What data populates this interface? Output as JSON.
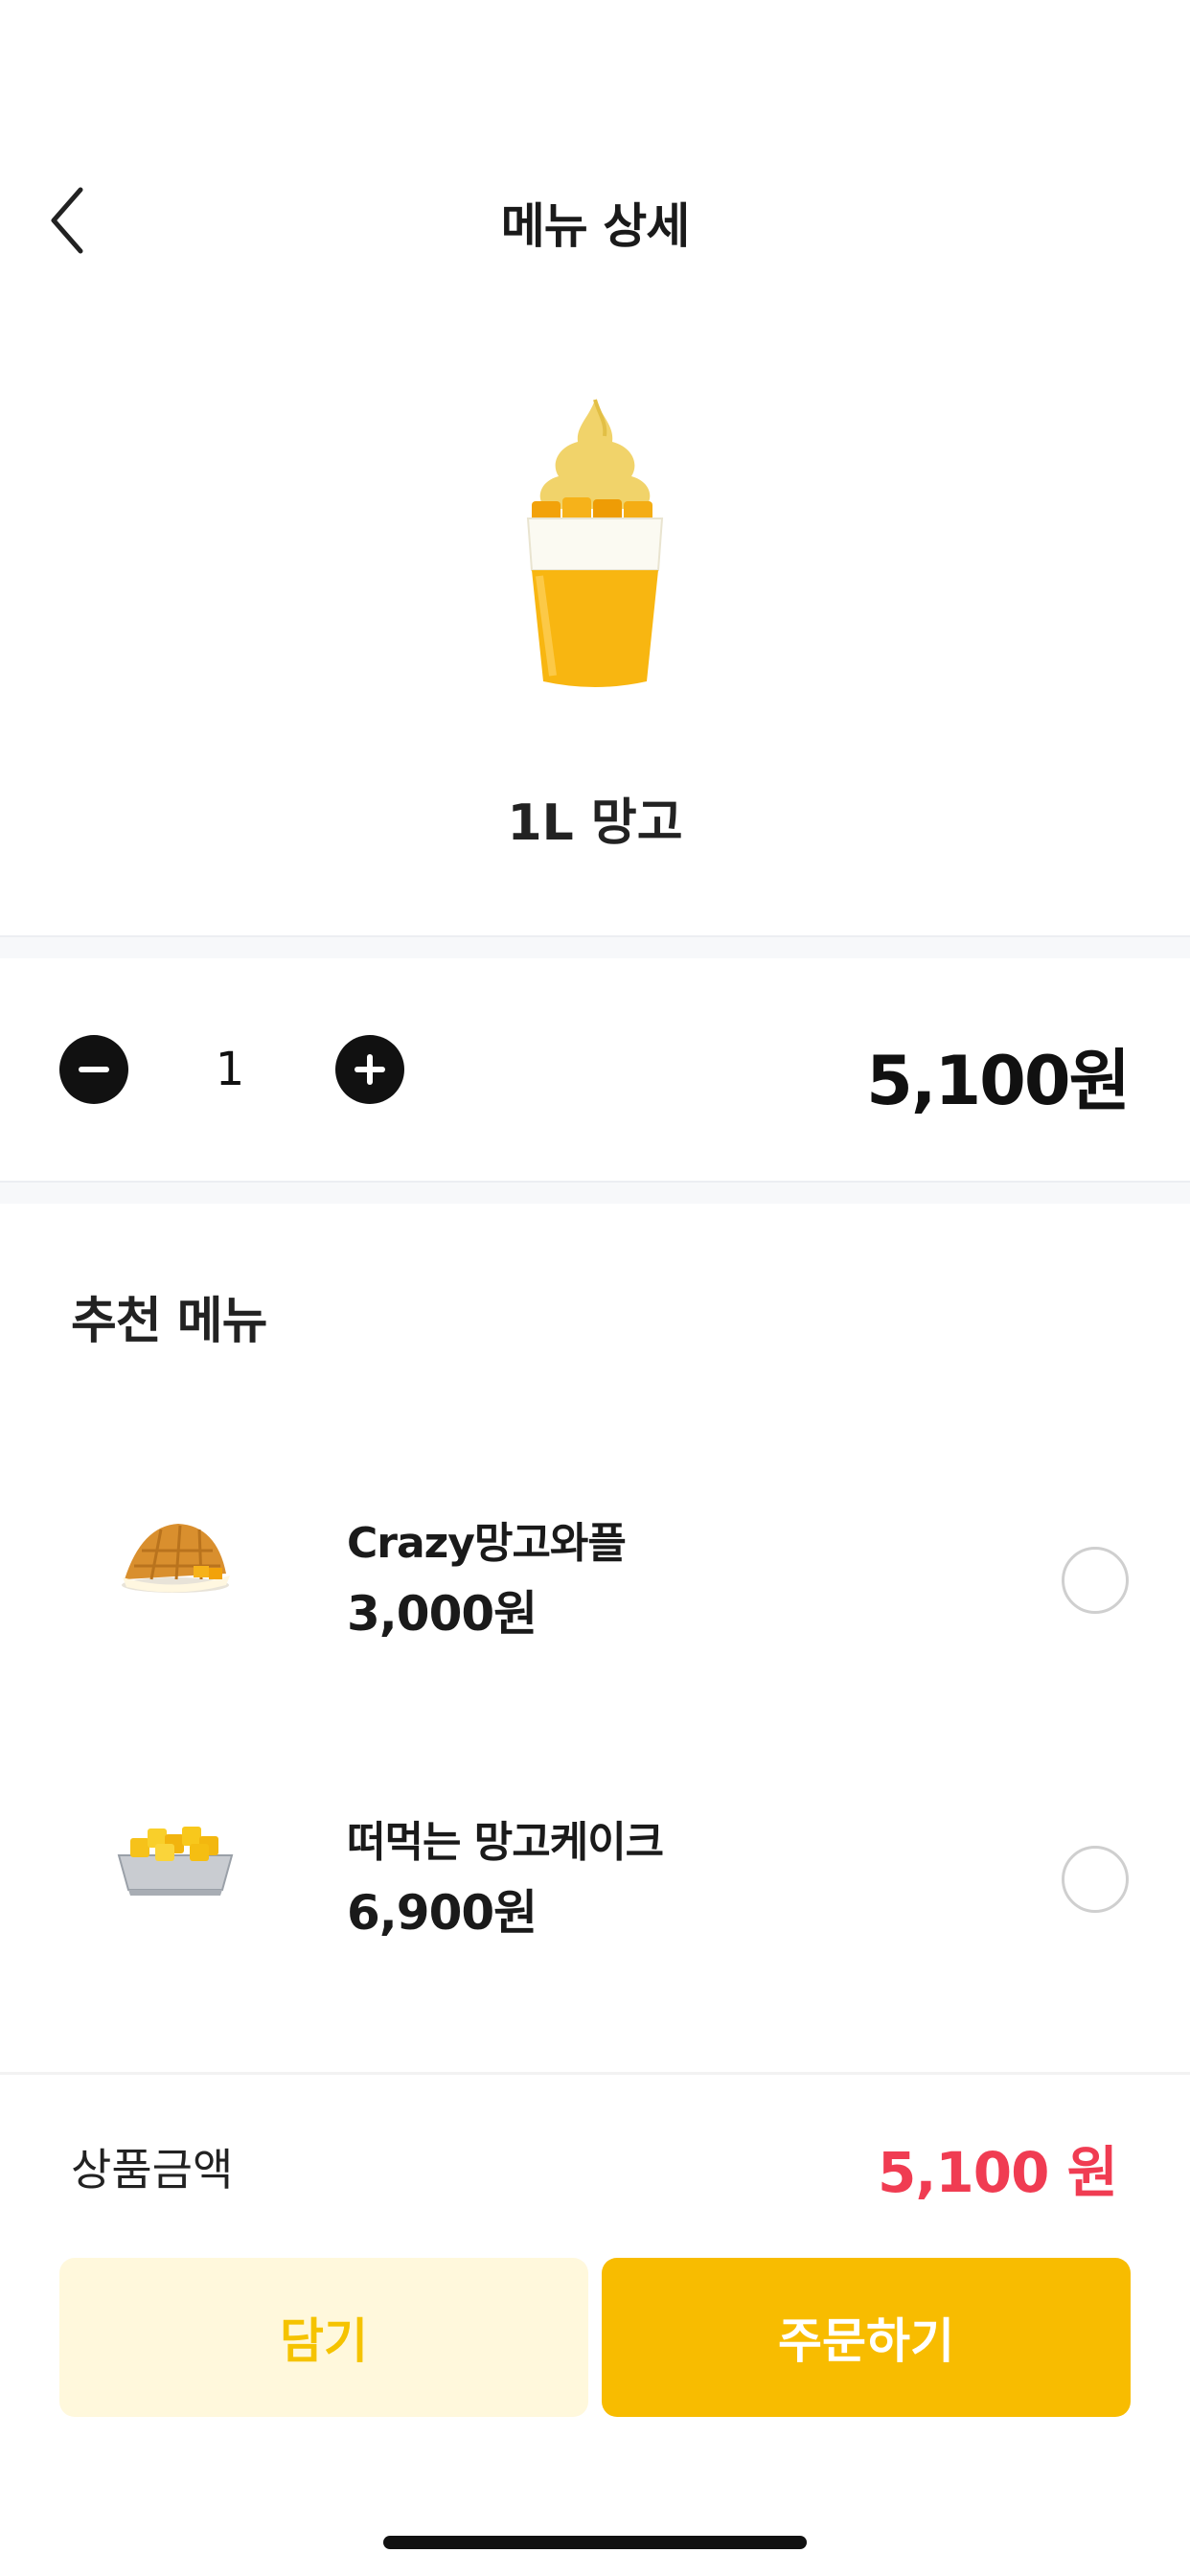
{
  "header": {
    "title": "메뉴 상세",
    "back_icon": "chevron-left-icon"
  },
  "product": {
    "name": "1L 망고",
    "image": "mango-smoothie-cup"
  },
  "quantity": {
    "value": "1",
    "minus_icon": "minus-circle-icon",
    "plus_icon": "plus-circle-icon",
    "price": "5,100원"
  },
  "recommendations": {
    "title": "추천 메뉴",
    "items": [
      {
        "name": "Crazy망고와플",
        "price": "3,000원",
        "image": "mango-waffle",
        "selected": false
      },
      {
        "name": "떠먹는 망고케이크",
        "price": "6,900원",
        "image": "mango-cake-tray",
        "selected": false
      }
    ]
  },
  "footer": {
    "total_label": "상품금액",
    "total_price": "5,100 원",
    "cart_label": "담기",
    "order_label": "주문하기"
  },
  "colors": {
    "accent": "#f8bc00",
    "accent_light": "#fff8dc",
    "price_red": "#f03c52"
  }
}
